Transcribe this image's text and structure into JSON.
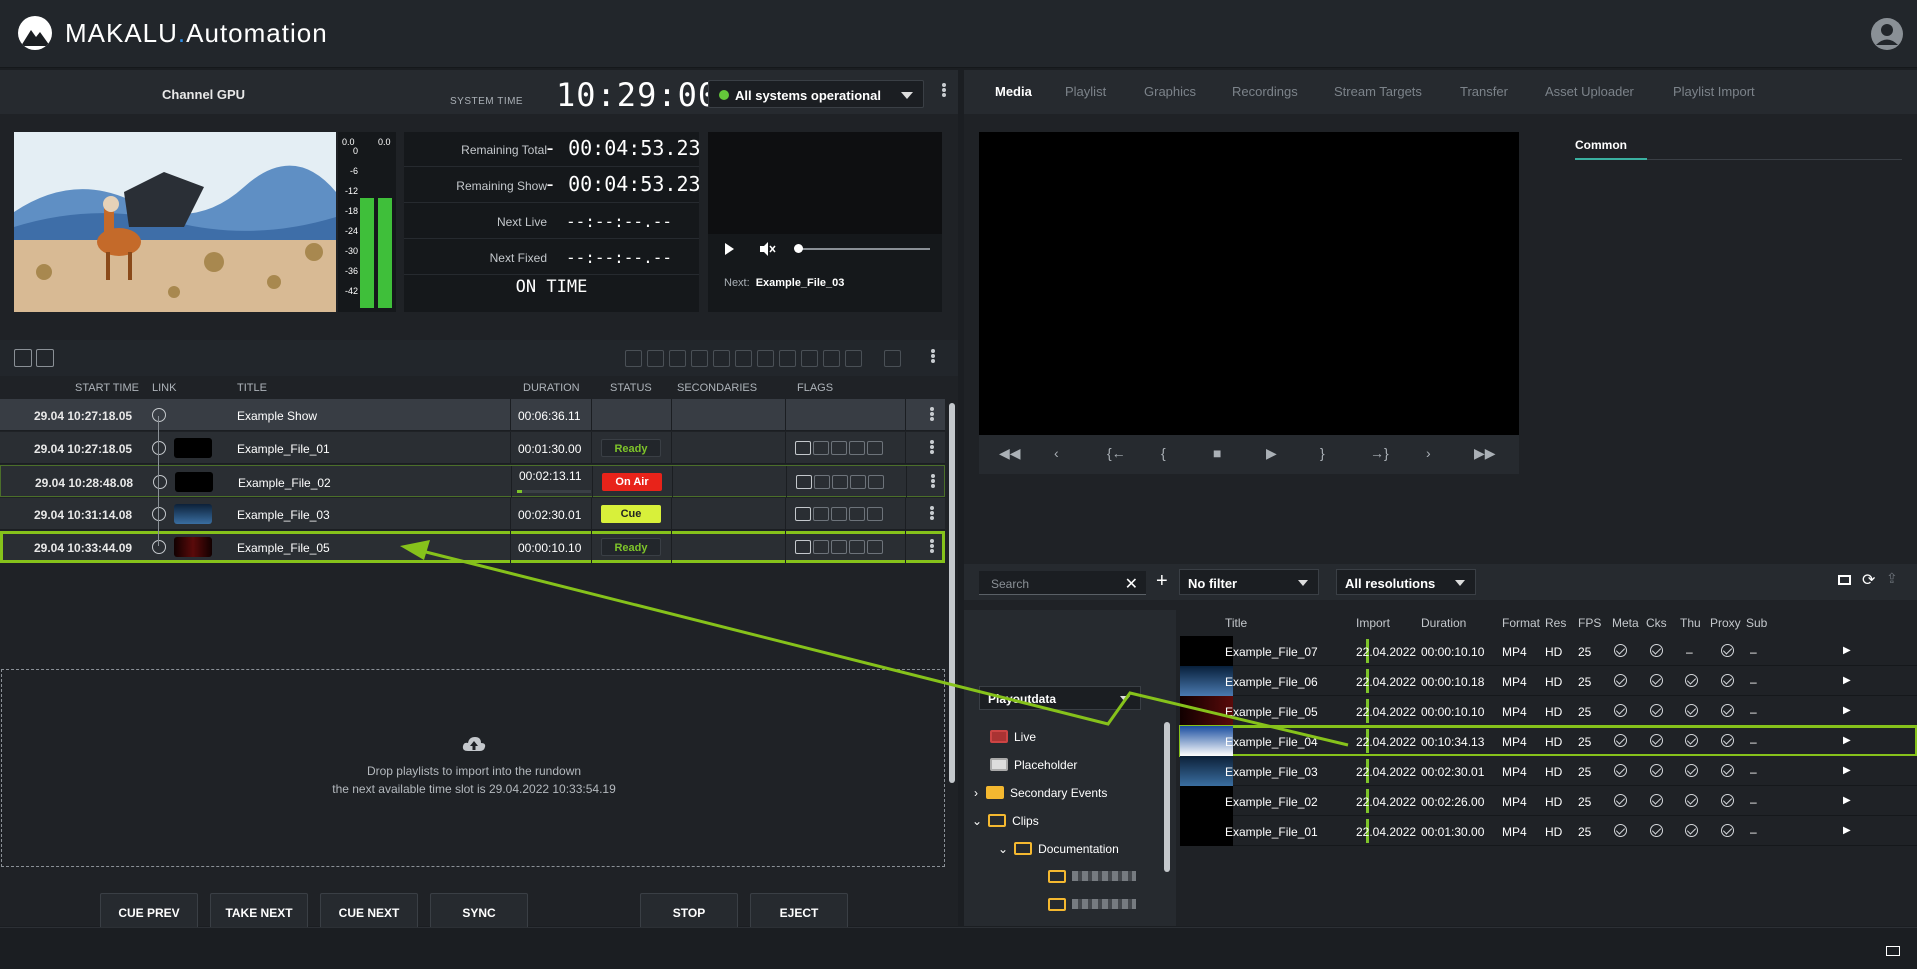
{
  "app": {
    "brand_main": "MAKALU",
    "brand_dot": ".",
    "brand_sub": "Automation"
  },
  "channel": {
    "name": "Channel GPU",
    "system_time_label": "SYSTEM TIME",
    "system_time": "10:29:00",
    "status": "All systems operational"
  },
  "vu": {
    "left_level": "0.0",
    "right_level": "0.0",
    "scale": [
      "0",
      "-6",
      "-12",
      "-18",
      "-24",
      "-30",
      "-36",
      "-42"
    ]
  },
  "counters": {
    "remaining_total_label": "Remaining Total",
    "remaining_total": "- 00:04:53.23",
    "remaining_show_label": "Remaining Show",
    "remaining_show": "- 00:04:53.23",
    "next_live_label": "Next Live",
    "next_live": "--:--:--.--",
    "next_fixed_label": "Next Fixed",
    "next_fixed": "--:--:--.--",
    "state": "ON TIME"
  },
  "mini_player": {
    "next_label": "Next:",
    "next_value": "Example_File_03"
  },
  "rundown": {
    "columns": {
      "start": "START TIME",
      "link": "LINK",
      "title": "TITLE",
      "duration": "DURATION",
      "status": "STATUS",
      "secondaries": "SECONDARIES",
      "flags": "FLAGS"
    },
    "rows": [
      {
        "time": "29.04  10:27:18.05",
        "title": "Example Show",
        "duration": "00:06:36.11",
        "status": ""
      },
      {
        "time": "29.04  10:27:18.05",
        "title": "Example_File_01",
        "duration": "00:01:30.00",
        "status": "Ready"
      },
      {
        "time": "29.04  10:28:48.08",
        "title": "Example_File_02",
        "duration": "00:02:13.11",
        "status": "On Air"
      },
      {
        "time": "29.04  10:31:14.08",
        "title": "Example_File_03",
        "duration": "00:02:30.01",
        "status": "Cue"
      },
      {
        "time": "29.04  10:33:44.09",
        "title": "Example_File_05",
        "duration": "00:00:10.10",
        "status": "Ready"
      }
    ],
    "drop_line1": "Drop playlists to import into the rundown",
    "drop_line2": "the next available time slot is 29.04.2022 10:33:54.19"
  },
  "controls": [
    {
      "label": "CUE PREV",
      "glyph": "|<"
    },
    {
      "label": "TAKE NEXT",
      "glyph": "▶"
    },
    {
      "label": "CUE NEXT",
      "glyph": ">|"
    },
    {
      "label": "SYNC",
      "glyph": "⟳"
    },
    {
      "label": "STOP",
      "glyph": "■"
    },
    {
      "label": "EJECT",
      "glyph": "⏏"
    }
  ],
  "tabs": [
    "Media",
    "Playlist",
    "Graphics",
    "Recordings",
    "Stream Targets",
    "Transfer",
    "Asset Uploader",
    "Playlist Import"
  ],
  "inspector_tab": "Common",
  "browser": {
    "search_placeholder": "Search",
    "filter": "No filter",
    "resolution": "All resolutions",
    "source": "Playoutdata",
    "tree": [
      "Live",
      "Placeholder",
      "Secondary Events",
      "Clips",
      "Documentation"
    ],
    "columns": {
      "title": "Title",
      "import": "Import",
      "duration": "Duration",
      "format": "Format",
      "res": "Res",
      "fps": "FPS",
      "meta": "Meta",
      "cks": "Cks",
      "thu": "Thu",
      "proxy": "Proxy",
      "sub": "Sub"
    },
    "rows": [
      {
        "title": "Example_File_07",
        "import": "22.04.2022",
        "duration": "00:00:10.10",
        "format": "MP4",
        "res": "HD",
        "fps": "25",
        "thu": "–",
        "sub": "–"
      },
      {
        "title": "Example_File_06",
        "import": "22.04.2022",
        "duration": "00:00:10.18",
        "format": "MP4",
        "res": "HD",
        "fps": "25",
        "thu": "ok",
        "sub": "–"
      },
      {
        "title": "Example_File_05",
        "import": "22.04.2022",
        "duration": "00:00:10.10",
        "format": "MP4",
        "res": "HD",
        "fps": "25",
        "thu": "ok",
        "sub": "–"
      },
      {
        "title": "Example_File_04",
        "import": "22.04.2022",
        "duration": "00:10:34.13",
        "format": "MP4",
        "res": "HD",
        "fps": "25",
        "thu": "ok",
        "sub": "–"
      },
      {
        "title": "Example_File_03",
        "import": "22.04.2022",
        "duration": "00:02:30.01",
        "format": "MP4",
        "res": "HD",
        "fps": "25",
        "thu": "ok",
        "sub": "–"
      },
      {
        "title": "Example_File_02",
        "import": "22.04.2022",
        "duration": "00:02:26.00",
        "format": "MP4",
        "res": "HD",
        "fps": "25",
        "thu": "ok",
        "sub": "–"
      },
      {
        "title": "Example_File_01",
        "import": "22.04.2022",
        "duration": "00:01:30.00",
        "format": "MP4",
        "res": "HD",
        "fps": "25",
        "thu": "ok",
        "sub": "–"
      }
    ]
  },
  "colors": {
    "accent": "#86c21b",
    "on_air": "#e8231a",
    "cue": "#d8f03a",
    "ready_text": "#7ec42a",
    "brand_dot": "#2f8fe8"
  }
}
